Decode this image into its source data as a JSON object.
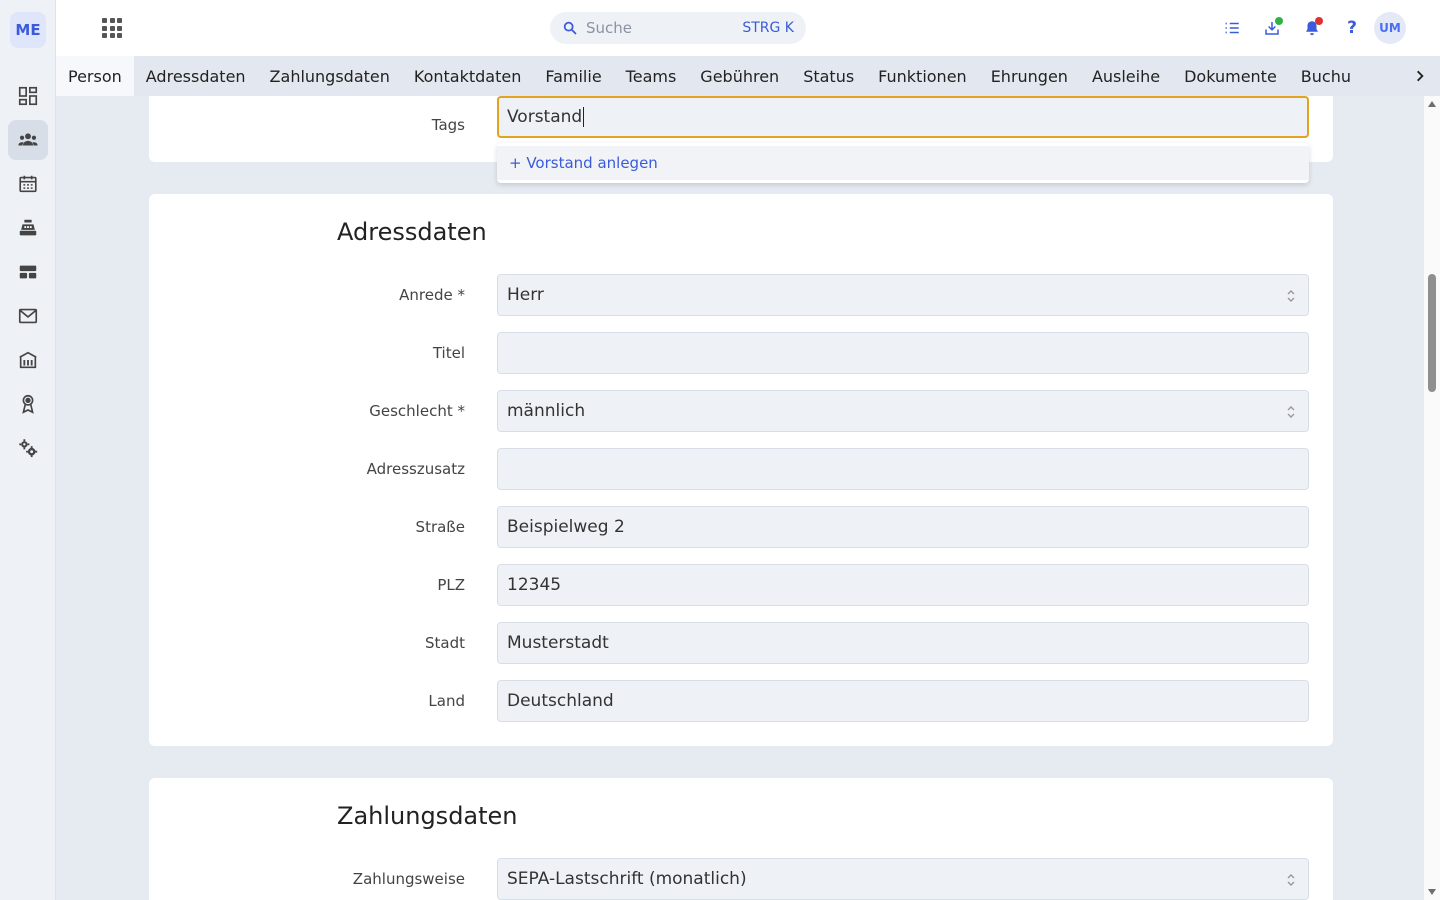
{
  "app": {
    "logo": "ME"
  },
  "sidebar": {
    "items": [
      {
        "icon": "dashboard-icon"
      },
      {
        "icon": "members-icon",
        "active": true
      },
      {
        "icon": "calendar-icon"
      },
      {
        "icon": "register-icon"
      },
      {
        "icon": "table-layout-icon"
      },
      {
        "icon": "mail-icon"
      },
      {
        "icon": "building-icon"
      },
      {
        "icon": "award-icon"
      },
      {
        "icon": "settings-icon"
      }
    ]
  },
  "topbar": {
    "search_placeholder": "Suche",
    "search_shortcut": "STRG K",
    "help": "?",
    "avatar": "UM",
    "colors": {
      "accent": "#3b5bdb",
      "dot_green": "#2fb344",
      "dot_red": "#e03131"
    }
  },
  "tabs": [
    {
      "label": "Person",
      "active": true
    },
    {
      "label": "Adressdaten"
    },
    {
      "label": "Zahlungsdaten"
    },
    {
      "label": "Kontaktdaten"
    },
    {
      "label": "Familie"
    },
    {
      "label": "Teams"
    },
    {
      "label": "Gebühren"
    },
    {
      "label": "Status"
    },
    {
      "label": "Funktionen"
    },
    {
      "label": "Ehrungen"
    },
    {
      "label": "Ausleihe"
    },
    {
      "label": "Dokumente"
    },
    {
      "label": "Buchu"
    }
  ],
  "person": {
    "tags_label": "Tags",
    "tags_value": "Vorstand",
    "tags_suggestion": "+ Vorstand anlegen"
  },
  "address": {
    "title": "Adressdaten",
    "fields": [
      {
        "label": "Anrede *",
        "value": "Herr",
        "type": "select"
      },
      {
        "label": "Titel",
        "value": "",
        "type": "text"
      },
      {
        "label": "Geschlecht *",
        "value": "männlich",
        "type": "select"
      },
      {
        "label": "Adresszusatz",
        "value": "",
        "type": "text"
      },
      {
        "label": "Straße",
        "value": "Beispielweg 2",
        "type": "text"
      },
      {
        "label": "PLZ",
        "value": "12345",
        "type": "text"
      },
      {
        "label": "Stadt",
        "value": "Musterstadt",
        "type": "text"
      },
      {
        "label": "Land",
        "value": "Deutschland",
        "type": "text"
      }
    ]
  },
  "payment": {
    "title": "Zahlungsdaten",
    "method_label": "Zahlungsweise",
    "method_value": "SEPA-Lastschrift (monatlich)"
  }
}
